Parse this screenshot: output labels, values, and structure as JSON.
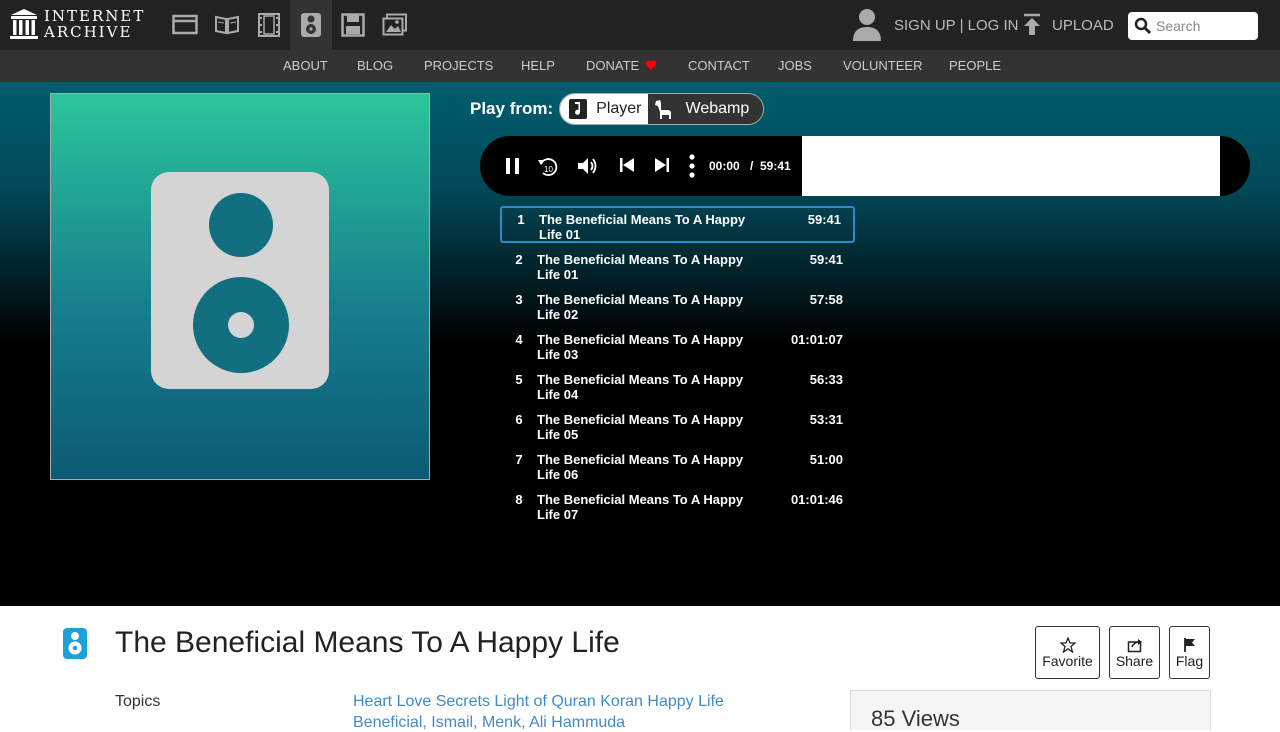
{
  "header": {
    "logo_line1": "INTERNET",
    "logo_line2": "ARCHIVE",
    "auth_links": "SIGN UP | LOG IN",
    "upload_label": "UPLOAD",
    "search_placeholder": "Search"
  },
  "nav": {
    "items": [
      "ABOUT",
      "BLOG",
      "PROJECTS",
      "HELP",
      "DONATE",
      "CONTACT",
      "JOBS",
      "VOLUNTEER",
      "PEOPLE"
    ]
  },
  "player": {
    "play_from_label": "Play from:",
    "player_label": "Player",
    "webamp_label": "Webamp",
    "current_time": "00:00",
    "separator": "/",
    "total_time": "59:41",
    "skip_back_seconds": "10"
  },
  "playlist": [
    {
      "num": "1",
      "title": "The Beneficial Means To A Happy Life 01",
      "duration": "59:41"
    },
    {
      "num": "2",
      "title": "The Beneficial Means To A Happy Life 01",
      "duration": "59:41"
    },
    {
      "num": "3",
      "title": "The Beneficial Means To A Happy Life 02",
      "duration": "57:58"
    },
    {
      "num": "4",
      "title": "The Beneficial Means To A Happy Life 03",
      "duration": "01:01:07"
    },
    {
      "num": "5",
      "title": "The Beneficial Means To A Happy Life 04",
      "duration": "56:33"
    },
    {
      "num": "6",
      "title": "The Beneficial Means To A Happy Life 05",
      "duration": "53:31"
    },
    {
      "num": "7",
      "title": "The Beneficial Means To A Happy Life 06",
      "duration": "51:00"
    },
    {
      "num": "8",
      "title": "The Beneficial Means To A Happy Life 07",
      "duration": "01:01:46"
    }
  ],
  "item": {
    "title": "The Beneficial Means To A Happy Life",
    "favorite_label": "Favorite",
    "share_label": "Share",
    "flag_label": "Flag",
    "topics_label": "Topics",
    "topics_value": "Heart Love Secrets Light of Quran Koran Happy Life",
    "topics_value_line2": "Beneficial, Ismail, Menk, Ali Hammuda",
    "views_text": "85 Views"
  },
  "colors": {
    "topbar": "#222222",
    "navbar": "#333333",
    "link": "#428bca",
    "active_track_border": "#2a8ccd",
    "donate_heart": "#ff0000"
  }
}
